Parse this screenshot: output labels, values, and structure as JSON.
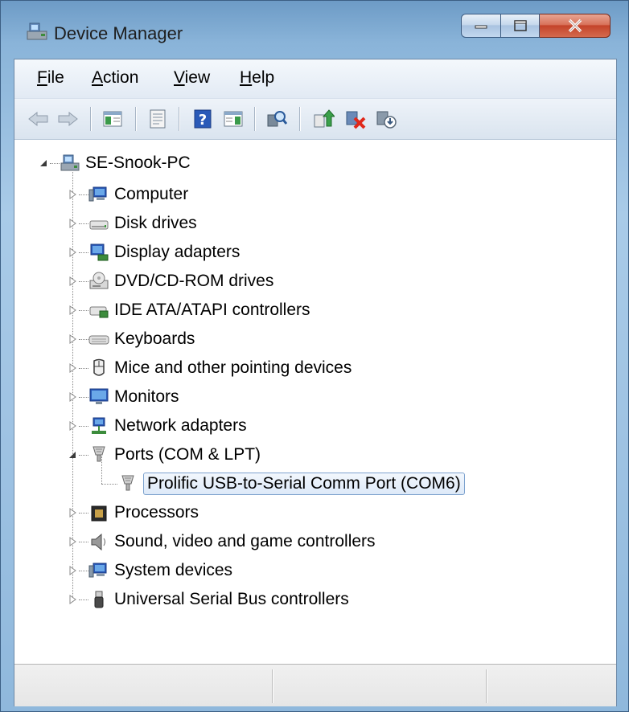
{
  "window": {
    "title": "Device Manager"
  },
  "menu": [
    {
      "label_pre": "",
      "label_ul": "F",
      "label_post": "ile"
    },
    {
      "label_pre": "",
      "label_ul": "A",
      "label_post": "ction"
    },
    {
      "label_pre": "",
      "label_ul": "V",
      "label_post": "iew"
    },
    {
      "label_pre": "",
      "label_ul": "H",
      "label_post": "elp"
    }
  ],
  "toolbar": {
    "icons": [
      "back-arrow-icon",
      "forward-arrow-icon",
      "show-hide-console-tree-icon",
      "properties-icon",
      "help-icon",
      "action-pane-icon",
      "scan-hardware-icon",
      "update-driver-icon",
      "uninstall-device-icon",
      "disable-device-icon"
    ]
  },
  "tree": {
    "root": {
      "label": "SE-Snook-PC",
      "expanded": true,
      "icon": "computer-root-icon"
    },
    "categories": [
      {
        "label": "Computer",
        "icon": "computer-icon",
        "expanded": false
      },
      {
        "label": "Disk drives",
        "icon": "disk-drive-icon",
        "expanded": false
      },
      {
        "label": "Display adapters",
        "icon": "display-adapter-icon",
        "expanded": false
      },
      {
        "label": "DVD/CD-ROM drives",
        "icon": "dvd-drive-icon",
        "expanded": false
      },
      {
        "label": "IDE ATA/ATAPI controllers",
        "icon": "ide-controller-icon",
        "expanded": false
      },
      {
        "label": "Keyboards",
        "icon": "keyboard-icon",
        "expanded": false
      },
      {
        "label": "Mice and other pointing devices",
        "icon": "mouse-icon",
        "expanded": false
      },
      {
        "label": "Monitors",
        "icon": "monitor-icon",
        "expanded": false
      },
      {
        "label": "Network adapters",
        "icon": "network-adapter-icon",
        "expanded": false
      },
      {
        "label": "Ports (COM & LPT)",
        "icon": "port-icon",
        "expanded": true
      },
      {
        "label": "Prolific USB-to-Serial Comm Port (COM6)",
        "icon": "port-icon",
        "child": true,
        "selected": true
      },
      {
        "label": "Processors",
        "icon": "processor-icon",
        "expanded": false
      },
      {
        "label": "Sound, video and game controllers",
        "icon": "speaker-icon",
        "expanded": false
      },
      {
        "label": "System devices",
        "icon": "system-devices-icon",
        "expanded": false
      },
      {
        "label": "Universal Serial Bus controllers",
        "icon": "usb-icon",
        "expanded": false
      }
    ]
  },
  "statusbar": {
    "panes": [
      "",
      "",
      ""
    ]
  }
}
